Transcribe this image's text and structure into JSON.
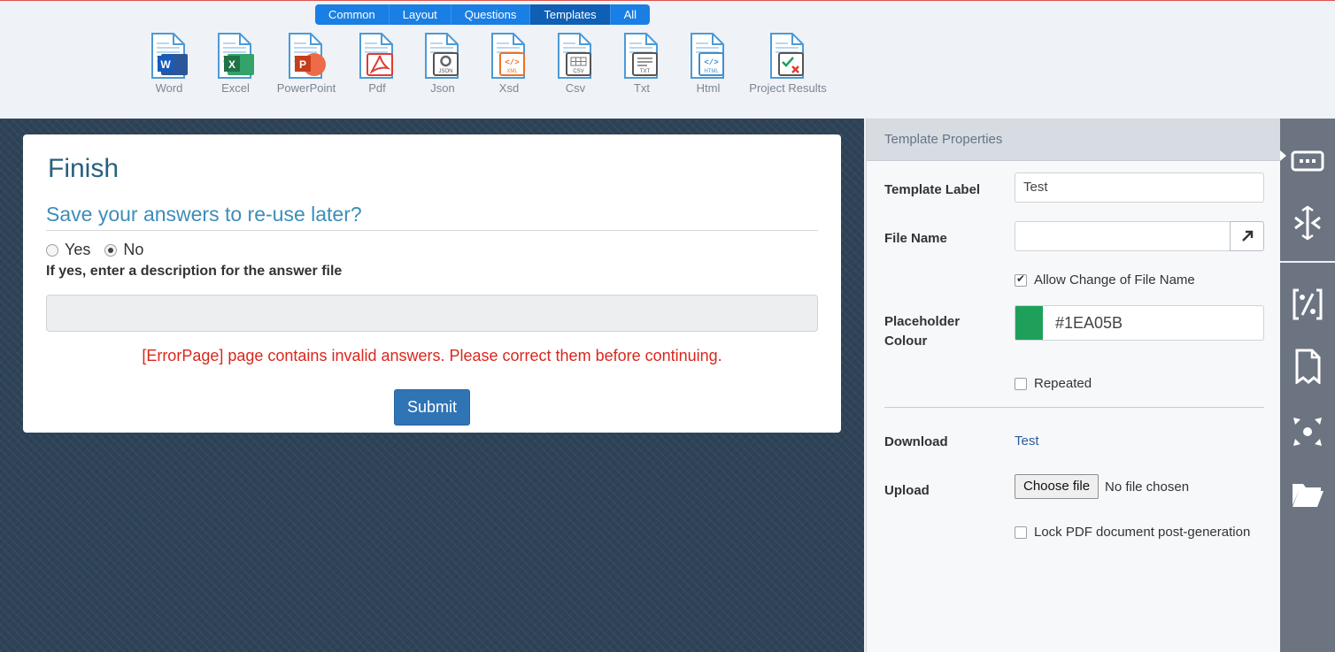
{
  "toolbar": {
    "tabs": [
      {
        "label": "Common",
        "active": false
      },
      {
        "label": "Layout",
        "active": false
      },
      {
        "label": "Questions",
        "active": false
      },
      {
        "label": "Templates",
        "active": true
      },
      {
        "label": "All",
        "active": false
      }
    ],
    "items": [
      {
        "label": "Word",
        "badge": "W",
        "badge_color": "#2b579a",
        "icon": "word-doc-icon"
      },
      {
        "label": "Excel",
        "badge": "X",
        "badge_color": "#217346",
        "icon": "excel-doc-icon"
      },
      {
        "label": "PowerPoint",
        "badge": "P",
        "badge_color": "#c94a25",
        "icon": "powerpoint-doc-icon"
      },
      {
        "label": "Pdf",
        "badge": "",
        "badge_color": "#e03c31",
        "icon": "pdf-doc-icon"
      },
      {
        "label": "Json",
        "badge": "JSON",
        "badge_color": "#555555",
        "icon": "json-doc-icon"
      },
      {
        "label": "Xsd",
        "badge": "XML",
        "badge_color": "#e8732c",
        "icon": "xsd-doc-icon"
      },
      {
        "label": "Csv",
        "badge": "CSV",
        "badge_color": "#555555",
        "icon": "csv-doc-icon"
      },
      {
        "label": "Txt",
        "badge": "TXT",
        "badge_color": "#555555",
        "icon": "txt-doc-icon"
      },
      {
        "label": "Html",
        "badge": "HTML",
        "badge_color": "#3f8fd0",
        "icon": "html-doc-icon"
      },
      {
        "label": "Project Results",
        "badge": "",
        "badge_color": "#e03c31",
        "icon": "project-results-doc-icon"
      }
    ]
  },
  "card": {
    "title": "Finish",
    "question": "Save your answers to re-use later?",
    "options": [
      {
        "label": "Yes",
        "selected": false
      },
      {
        "label": "No",
        "selected": true
      }
    ],
    "description_label": "If yes, enter a description for the answer file",
    "description_value": "",
    "error": "[ErrorPage] page contains invalid answers. Please correct them before continuing.",
    "submit_label": "Submit"
  },
  "properties": {
    "header": "Template Properties",
    "template_label": {
      "label": "Template Label",
      "value": "Test"
    },
    "file_name": {
      "label": "File Name",
      "value": ""
    },
    "allow_change": {
      "label": "Allow Change of File Name",
      "checked": true
    },
    "placeholder_colour": {
      "label": "Placeholder Colour",
      "value": "#1EA05B"
    },
    "repeated": {
      "label": "Repeated",
      "checked": false
    },
    "download": {
      "label": "Download",
      "link": "Test"
    },
    "upload": {
      "label": "Upload",
      "button": "Choose file",
      "status": "No file chosen"
    },
    "lock_pdf": {
      "label": "Lock PDF document post-generation",
      "checked": false
    }
  },
  "rail": {
    "icons": [
      "dialog-icon",
      "split-icon",
      "code-percent-icon",
      "document-bookmark-icon",
      "expand-icon",
      "folder-icon"
    ]
  },
  "colors": {
    "accent": "#1a7fe4",
    "title": "#27617d",
    "error": "#d9271d",
    "button": "#2f74b4",
    "canvas": "#2f4358",
    "rail": "#6b7480"
  }
}
